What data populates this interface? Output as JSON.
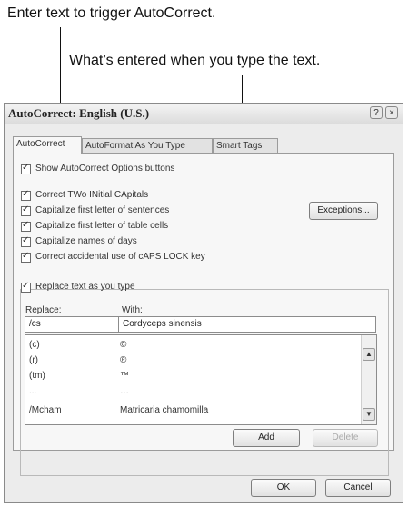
{
  "callouts": {
    "top": "Enter text to trigger AutoCorrect.",
    "second": "What’s entered when you type the text."
  },
  "dialog": {
    "title": "AutoCorrect: English (U.S.)",
    "help_glyph": "?",
    "close_glyph": "×",
    "tabs": [
      "AutoCorrect",
      "AutoFormat As You Type",
      "Smart Tags"
    ],
    "show_options": "Show AutoCorrect Options buttons",
    "options": [
      "Correct TWo INitial CApitals",
      "Capitalize first letter of sentences",
      "Capitalize first letter of table cells",
      "Capitalize names of days",
      "Correct accidental use of cAPS LOCK key"
    ],
    "exceptions_label": "Exceptions...",
    "replace_option": "Replace text as you type",
    "replace_label": "Replace:",
    "with_label": "With:",
    "replace_value": "/cs",
    "with_value": "Cordyceps sinensis",
    "list": [
      {
        "replace": "(c)",
        "with": "©"
      },
      {
        "replace": "(r)",
        "with": "®"
      },
      {
        "replace": "(tm)",
        "with": "™"
      },
      {
        "replace": "...",
        "with": "…"
      },
      {
        "replace": "/Mcham",
        "with": "Matricaria chamomilla"
      }
    ],
    "add_label": "Add",
    "delete_label": "Delete",
    "ok_label": "OK",
    "cancel_label": "Cancel"
  }
}
